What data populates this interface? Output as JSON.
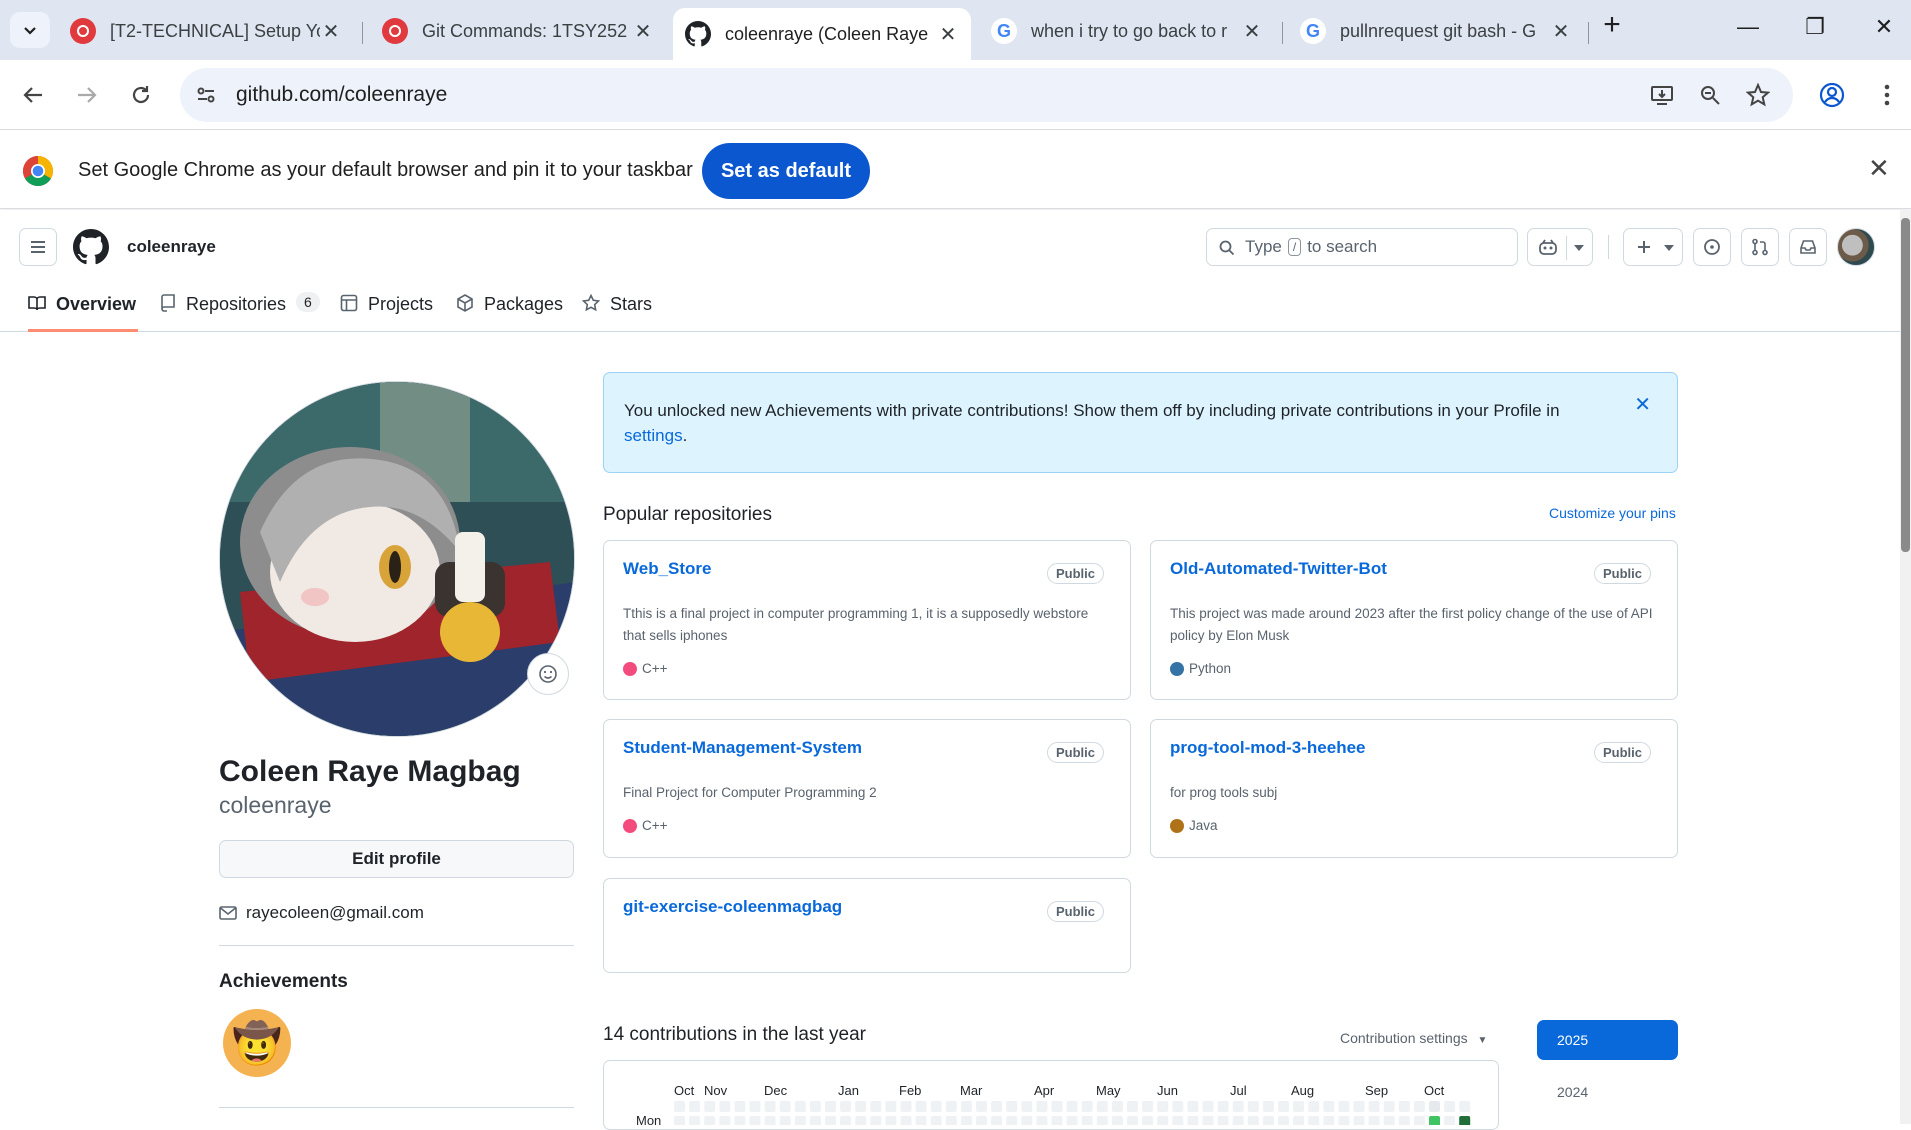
{
  "browser": {
    "tabs": [
      {
        "title": "[T2-TECHNICAL] Setup Yo",
        "icon": "redhat-icon"
      },
      {
        "title": "Git Commands: 1TSY252",
        "icon": "redhat-icon"
      },
      {
        "title": "coleenraye (Coleen Raye",
        "icon": "github-icon"
      },
      {
        "title": "when i try to go back to r",
        "icon": "google-icon"
      },
      {
        "title": "pullnrequest git bash - G",
        "icon": "google-icon"
      }
    ],
    "url": "github.com/coleenraye",
    "infobar_message": "Set Google Chrome as your default browser and pin it to your taskbar",
    "infobar_button": "Set as default"
  },
  "header": {
    "username": "coleenraye",
    "search_before": "Type",
    "search_key": "/",
    "search_after": "to search"
  },
  "profile_tabs": [
    {
      "label": "Overview"
    },
    {
      "label": "Repositories",
      "count": "6"
    },
    {
      "label": "Projects"
    },
    {
      "label": "Packages"
    },
    {
      "label": "Stars"
    }
  ],
  "profile": {
    "full_name": "Coleen Raye Magbag",
    "login": "coleenraye",
    "edit_button": "Edit profile",
    "email": "rayecoleen@gmail.com",
    "achievements_title": "Achievements"
  },
  "flash": {
    "message": "You unlocked new Achievements with private contributions! Show them off by including private contributions in your Profile in",
    "link": "settings",
    "suffix": "."
  },
  "popular": {
    "title": "Popular repositories",
    "customize": "Customize your pins",
    "repos": [
      {
        "name": "Web_Store",
        "visibility": "Public",
        "description": "Tthis is a final project in computer programming 1, it is a supposedly webstore that sells iphones",
        "language": "C++",
        "lang_color": "#f34b7d"
      },
      {
        "name": "Old-Automated-Twitter-Bot",
        "visibility": "Public",
        "description": "This project was made around 2023 after the first policy change of the use of API policy by Elon Musk",
        "language": "Python",
        "lang_color": "#3572A5"
      },
      {
        "name": "Student-Management-System",
        "visibility": "Public",
        "description": "Final Project for Computer Programming 2",
        "language": "C++",
        "lang_color": "#f34b7d"
      },
      {
        "name": "prog-tool-mod-3-heehee",
        "visibility": "Public",
        "description": "for prog tools subj",
        "language": "Java",
        "lang_color": "#b07219"
      },
      {
        "name": "git-exercise-coleenmagbag",
        "visibility": "Public",
        "description": "",
        "language": "",
        "lang_color": ""
      }
    ]
  },
  "contributions": {
    "title": "14 contributions in the last year",
    "settings": "Contribution settings",
    "months": [
      "Oct",
      "Nov",
      "Dec",
      "Jan",
      "Feb",
      "Mar",
      "Apr",
      "May",
      "Jun",
      "Jul",
      "Aug",
      "Sep",
      "Oct"
    ],
    "day_label": "Mon",
    "years": [
      "2025",
      "2024"
    ]
  }
}
